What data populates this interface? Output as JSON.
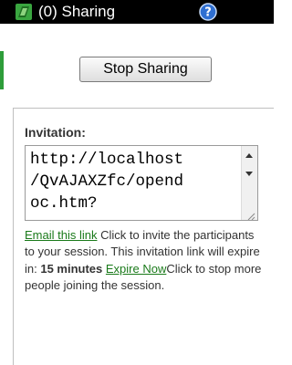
{
  "titlebar": {
    "title": "(0) Sharing",
    "app_icon": "green-flag-icon",
    "help_icon": "help-icon"
  },
  "stop_button": {
    "label": "Stop Sharing"
  },
  "invitation": {
    "label": "Invitation:",
    "url_lines": [
      "http://localhost",
      "/QvAJAXZfc/opend",
      "oc.htm?"
    ],
    "email_link": "Email this link",
    "text_after_email": " Click to invite the participants to your session. This invitation link will expire in: ",
    "expiry": "15 minutes",
    "expire_now_link": "Expire Now",
    "text_after_expire": "Click to stop more people joining the session."
  },
  "colors": {
    "titlebar_bg": "#000000",
    "link_green": "#1a7a1a",
    "accent_green": "#2e9d3a"
  }
}
